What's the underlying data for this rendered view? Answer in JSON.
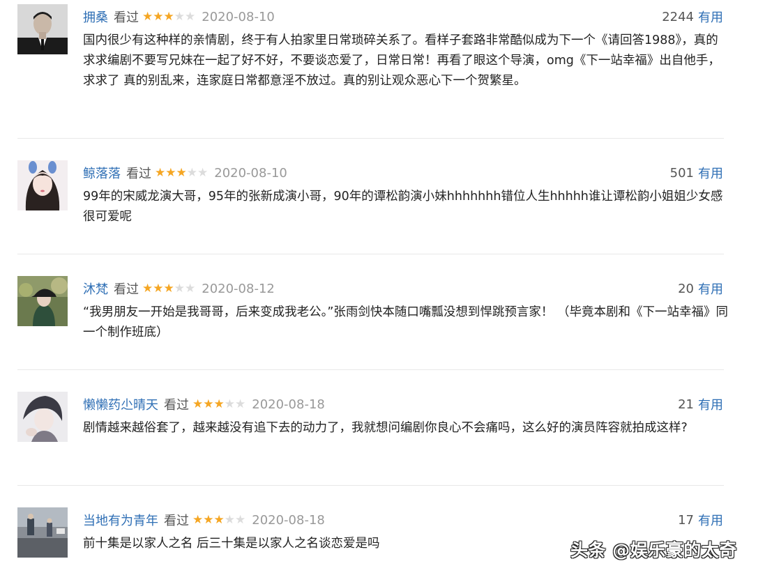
{
  "reviews": [
    {
      "username": "拥桑",
      "status": "看过",
      "rating": 3,
      "date": "2020-08-10",
      "votes": "2244",
      "useful_label": "有用",
      "content": "国内很少有这种样的亲情剧，终于有人拍家里日常琐碎关系了。看样子套路非常酷似成为下一个《请回答1988》，真的求求编剧不要写兄妹在一起了好不好，不要谈恋爱了，日常日常！再看了眼这个导演，omg《下一站幸福》出自他手，求求了 真的别乱来，连家庭日常都意淫不放过。真的别让观众恶心下一个贺繁星。"
    },
    {
      "username": "鲸落落",
      "status": "看过",
      "rating": 3,
      "date": "2020-08-10",
      "votes": "501",
      "useful_label": "有用",
      "content": "99年的宋威龙演大哥，95年的张新成演小哥，90年的谭松韵演小妹hhhhhhh错位人生hhhhh谁让谭松韵小姐姐少女感很可爱呢"
    },
    {
      "username": "沐梵",
      "status": "看过",
      "rating": 3,
      "date": "2020-08-12",
      "votes": "20",
      "useful_label": "有用",
      "content": "“我男朋友一开始是我哥哥，后来变成我老公。”张雨剑快本随口嘴瓢没想到悍跳预言家！ （毕竟本剧和《下一站幸福》同一个制作班底）"
    },
    {
      "username": "懒懒药尐晴天",
      "status": "看过",
      "rating": 3,
      "date": "2020-08-18",
      "votes": "21",
      "useful_label": "有用",
      "content": "剧情越来越俗套了，越来越没有追下去的动力了，我就想问编剧你良心不会痛吗，这么好的演员阵容就拍成这样?"
    },
    {
      "username": "当地有为青年",
      "status": "看过",
      "rating": 3,
      "date": "2020-08-18",
      "votes": "17",
      "useful_label": "有用",
      "content": "前十集是以家人之名 后三十集是以家人之名谈恋爱是吗"
    }
  ],
  "watermark": "头条 @娱乐豪的太奇",
  "colors": {
    "link": "#2f6fb5",
    "star_on": "#f5a623",
    "star_off": "#dcdcdc",
    "date": "#999999"
  }
}
